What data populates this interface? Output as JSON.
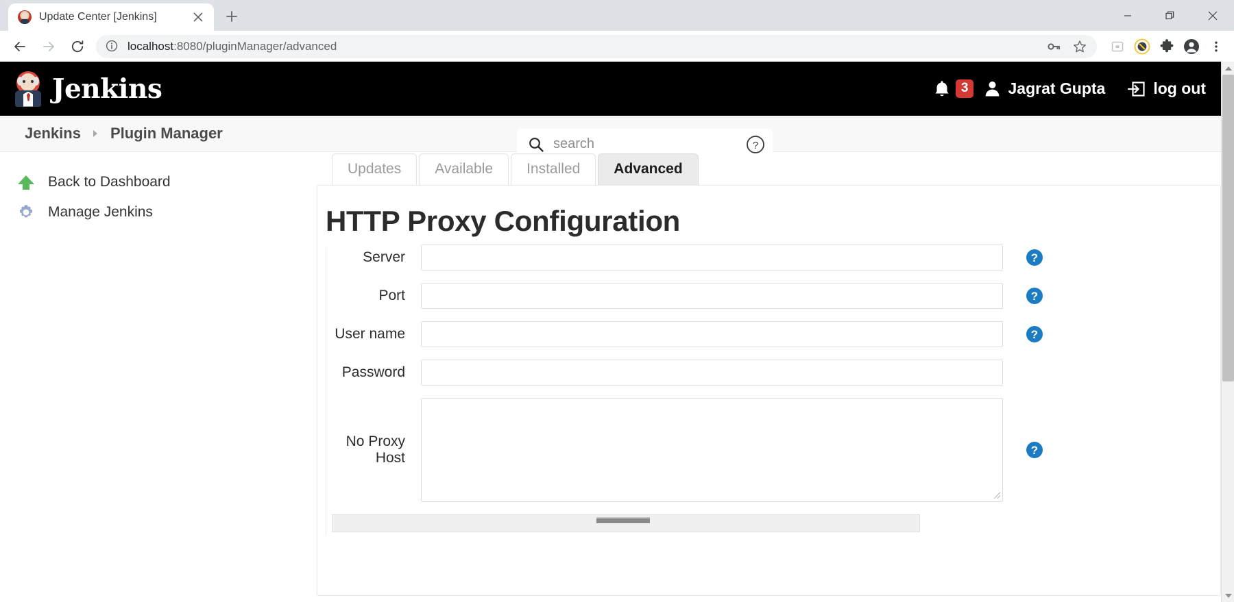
{
  "browser": {
    "tab": {
      "title": "Update Center [Jenkins]",
      "favicon": "jenkins-butler-icon",
      "close_label": "✕"
    },
    "new_tab_label": "+",
    "window_controls": {
      "minimize": "—",
      "restore": "❐",
      "close": "✕"
    },
    "nav": {
      "back": "←",
      "forward": "→",
      "reload": "⟳"
    },
    "omnibox": {
      "info_icon": "site-info-icon",
      "url_host": "localhost",
      "url_path": ":8080/pluginManager/advanced",
      "url_full": "localhost:8080/pluginManager/advanced"
    },
    "omnibox_actions": [
      "key-icon",
      "star-icon"
    ],
    "extensions": [
      "media-cast-icon",
      "adblock-icon",
      "puzzle-extensions-icon",
      "profile-avatar-icon",
      "three-dot-menu-icon"
    ]
  },
  "jenkins": {
    "logo_text": "Jenkins",
    "search": {
      "placeholder": "search",
      "value": "",
      "help_icon": "question-circle-icon"
    },
    "notifications": {
      "count": "3",
      "icon": "bell-icon"
    },
    "user": {
      "name": "Jagrat Gupta",
      "icon": "person-icon"
    },
    "logout": {
      "label": "log out",
      "icon": "logout-arrow-icon"
    }
  },
  "breadcrumb": {
    "items": [
      {
        "label": "Jenkins"
      },
      {
        "label": "Plugin Manager"
      }
    ],
    "separator": "▸"
  },
  "sidebar": {
    "items": [
      {
        "label": "Back to Dashboard",
        "icon": "green-up-arrow-icon"
      },
      {
        "label": "Manage Jenkins",
        "icon": "gear-icon"
      }
    ]
  },
  "plugin_manager": {
    "tabs": [
      {
        "label": "Updates",
        "active": false
      },
      {
        "label": "Available",
        "active": false
      },
      {
        "label": "Installed",
        "active": false
      },
      {
        "label": "Advanced",
        "active": true
      }
    ],
    "section_title": "HTTP Proxy Configuration",
    "help_icon_label": "?",
    "fields": [
      {
        "label": "Server",
        "value": "",
        "type": "text"
      },
      {
        "label": "Port",
        "value": "",
        "type": "text"
      },
      {
        "label": "User name",
        "value": "",
        "type": "text"
      },
      {
        "label": "Password",
        "value": "",
        "type": "password"
      },
      {
        "label": "No Proxy Host",
        "value": "",
        "type": "textarea"
      }
    ]
  },
  "colors": {
    "header_bg": "#000000",
    "accent_blue": "#1b7cc4",
    "badge_red": "#d33833",
    "active_tab_bg": "#ebebeb",
    "sidebar_arrow_green": "#5cb85c"
  }
}
